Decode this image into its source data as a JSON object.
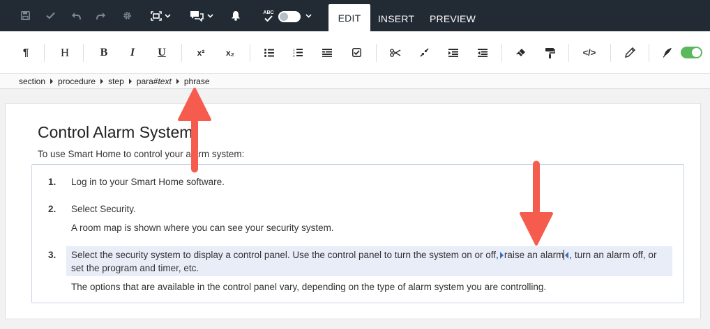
{
  "topbar": {
    "tabs": [
      {
        "label": "EDIT",
        "active": true
      },
      {
        "label": "INSERT",
        "active": false
      },
      {
        "label": "PREVIEW",
        "active": false
      }
    ],
    "spell_label": "ABC",
    "icons": [
      "save-icon",
      "check-icon",
      "undo-icon",
      "redo-icon",
      "gear-icon",
      "fit-view-icon",
      "comments-icon",
      "bell-icon",
      "spellcheck-icon"
    ]
  },
  "toolbar": {
    "pilcrow": "¶",
    "heading": "H",
    "bold": "B",
    "italic": "I",
    "underline": "U",
    "superscript": "x²",
    "subscript": "x₂",
    "code": "</>"
  },
  "breadcrumb": {
    "items": [
      "section",
      "procedure",
      "step",
      "para#",
      "text",
      "phrase"
    ]
  },
  "document": {
    "title": "Control Alarm System",
    "intro": "To use Smart Home to control your alarm system:",
    "steps": [
      {
        "num": "1.",
        "text": "Log in to your Smart Home software."
      },
      {
        "num": "2.",
        "text": "Select Security.",
        "info": "A room map is shown where you can see your security system."
      },
      {
        "num": "3.",
        "line1_a": "Select the security system to display a control panel. Use the control panel to turn the system on or off,",
        "phrase": "raise an alarm",
        "line1_b": ", turn an alarm off, or",
        "line2": "set the program and timer, etc.",
        "info": "The options that are available in the control panel vary, depending on the type of alarm system you are controlling."
      }
    ]
  },
  "colors": {
    "topbar": "#222a33",
    "arrow": "#f65c4e",
    "highlight": "#e9edf8",
    "toggle_on": "#5cb85c"
  }
}
